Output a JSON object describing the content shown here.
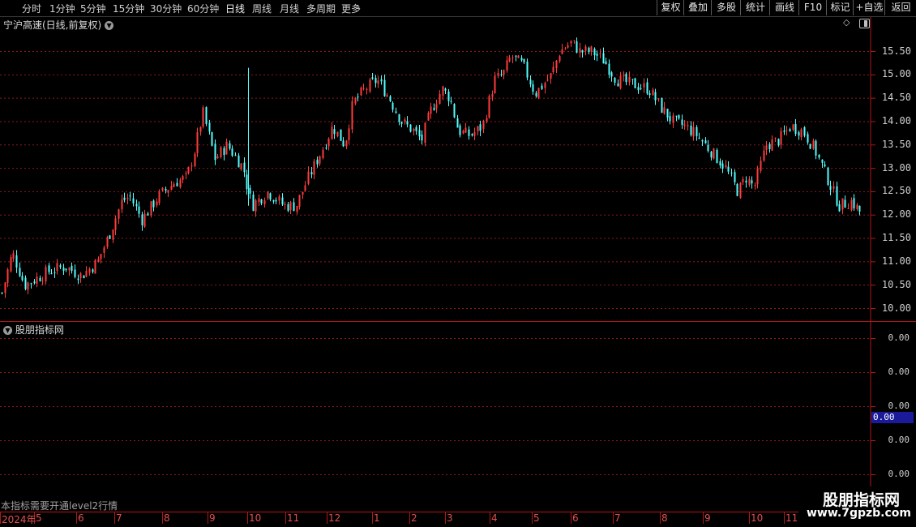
{
  "toolbar": {
    "timeframes": [
      "分时",
      "1分钟",
      "5分钟",
      "15分钟",
      "30分钟",
      "60分钟",
      "日线",
      "周线",
      "月线",
      "多周期",
      "更多"
    ],
    "active": "日线",
    "right_buttons": [
      "复权",
      "叠加",
      "多股",
      "统计",
      "画线",
      "F10",
      "标记",
      "+自选",
      "返回"
    ]
  },
  "main": {
    "stock_title": "宁沪高速(日线,前复权)",
    "y_ticks": [
      "15.50",
      "15.00",
      "14.50",
      "14.00",
      "13.50",
      "13.00",
      "12.50",
      "12.00",
      "11.50",
      "11.00",
      "10.50",
      "10.00"
    ]
  },
  "indicator": {
    "title": "股朋指标网",
    "y_ticks": [
      "0.00",
      "0.00",
      "0.00",
      "0.00",
      "0.00"
    ],
    "current_value": "0.00",
    "note": "本指标需要开通level2行情"
  },
  "x_axis": {
    "labels": [
      "2024年",
      "5",
      "6",
      "7",
      "8",
      "9",
      "10",
      "11",
      "12",
      "1",
      "2",
      "3",
      "4",
      "5",
      "6",
      "7",
      "8",
      "9",
      "10",
      "11"
    ]
  },
  "watermark": {
    "title": "股朋指标网",
    "url": "www.7gpzb.com"
  },
  "colors": {
    "up": "#ff3c3c",
    "down": "#54ffff",
    "grid": "#8b1a1a",
    "frame": "#b01818"
  },
  "chart_data": {
    "type": "candlestick",
    "ylim": [
      9.8,
      15.95
    ],
    "anchors": [
      [
        0,
        10.2
      ],
      [
        15,
        11.2
      ],
      [
        30,
        10.5
      ],
      [
        60,
        10.8
      ],
      [
        80,
        10.9
      ],
      [
        100,
        10.7
      ],
      [
        120,
        11.0
      ],
      [
        135,
        11.6
      ],
      [
        150,
        12.3
      ],
      [
        160,
        12.4
      ],
      [
        175,
        11.9
      ],
      [
        195,
        12.4
      ],
      [
        215,
        12.7
      ],
      [
        230,
        12.8
      ],
      [
        240,
        13.4
      ],
      [
        250,
        14.2
      ],
      [
        256,
        13.8
      ],
      [
        265,
        13.2
      ],
      [
        280,
        13.5
      ],
      [
        300,
        13.0
      ],
      [
        310,
        12.2
      ],
      [
        330,
        12.5
      ],
      [
        350,
        12.2
      ],
      [
        365,
        12.2
      ],
      [
        380,
        12.8
      ],
      [
        400,
        13.5
      ],
      [
        410,
        13.9
      ],
      [
        425,
        13.5
      ],
      [
        435,
        14.4
      ],
      [
        450,
        14.7
      ],
      [
        465,
        14.9
      ],
      [
        480,
        14.5
      ],
      [
        495,
        14.0
      ],
      [
        510,
        13.8
      ],
      [
        520,
        13.6
      ],
      [
        530,
        14.2
      ],
      [
        545,
        14.7
      ],
      [
        555,
        14.5
      ],
      [
        565,
        13.8
      ],
      [
        580,
        13.7
      ],
      [
        595,
        13.9
      ],
      [
        610,
        14.9
      ],
      [
        620,
        15.0
      ],
      [
        630,
        15.4
      ],
      [
        645,
        15.2
      ],
      [
        660,
        14.6
      ],
      [
        680,
        15.0
      ],
      [
        690,
        15.5
      ],
      [
        705,
        15.7
      ],
      [
        715,
        15.5
      ],
      [
        730,
        15.5
      ],
      [
        745,
        15.3
      ],
      [
        760,
        14.9
      ],
      [
        780,
        14.8
      ],
      [
        800,
        14.7
      ],
      [
        815,
        14.3
      ],
      [
        830,
        14.0
      ],
      [
        845,
        13.9
      ],
      [
        860,
        13.7
      ],
      [
        875,
        13.4
      ],
      [
        895,
        13.0
      ],
      [
        910,
        12.5
      ],
      [
        920,
        12.8
      ],
      [
        930,
        12.6
      ],
      [
        945,
        13.5
      ],
      [
        960,
        13.6
      ],
      [
        975,
        13.9
      ],
      [
        990,
        13.8
      ],
      [
        1005,
        13.4
      ],
      [
        1020,
        12.8
      ],
      [
        1035,
        12.2
      ],
      [
        1050,
        12.3
      ],
      [
        1064,
        12.0
      ]
    ]
  }
}
